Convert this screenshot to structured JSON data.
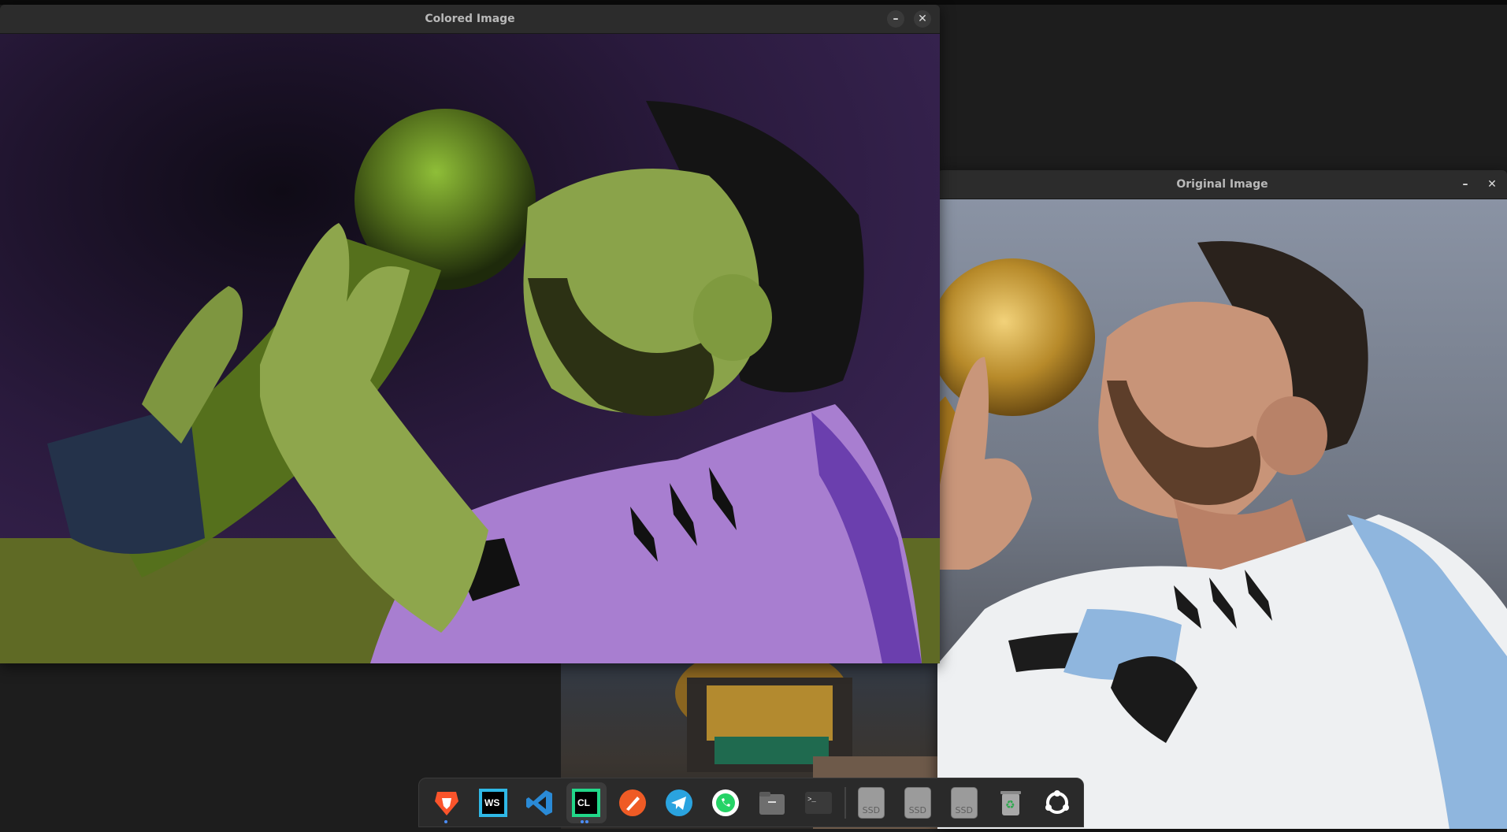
{
  "windows": {
    "colored": {
      "title": "Colored Image",
      "minimize": "–",
      "close": "✕"
    },
    "original": {
      "title": "Original Image",
      "minimize": "–",
      "close": "✕"
    }
  },
  "dock": {
    "items": [
      {
        "name": "brave-browser-icon",
        "running": true
      },
      {
        "name": "webstorm-icon",
        "label": "WS"
      },
      {
        "name": "vscode-icon"
      },
      {
        "name": "clion-icon",
        "label": "CL",
        "active": true,
        "running": true
      },
      {
        "name": "postman-icon"
      },
      {
        "name": "telegram-icon"
      },
      {
        "name": "whatsapp-icon"
      },
      {
        "name": "files-icon"
      },
      {
        "name": "terminal-icon",
        "label": ">_"
      },
      {
        "name": "ssd-drive-icon-1",
        "label": "SSD"
      },
      {
        "name": "ssd-drive-icon-2",
        "label": "SSD"
      },
      {
        "name": "ssd-drive-icon-3",
        "label": "SSD"
      },
      {
        "name": "trash-icon"
      },
      {
        "name": "ubuntu-apps-icon"
      }
    ]
  },
  "colors": {
    "accent": "#4b8df8",
    "desktop": "#1d1d1d",
    "titlebar": "#2c2c2c"
  }
}
